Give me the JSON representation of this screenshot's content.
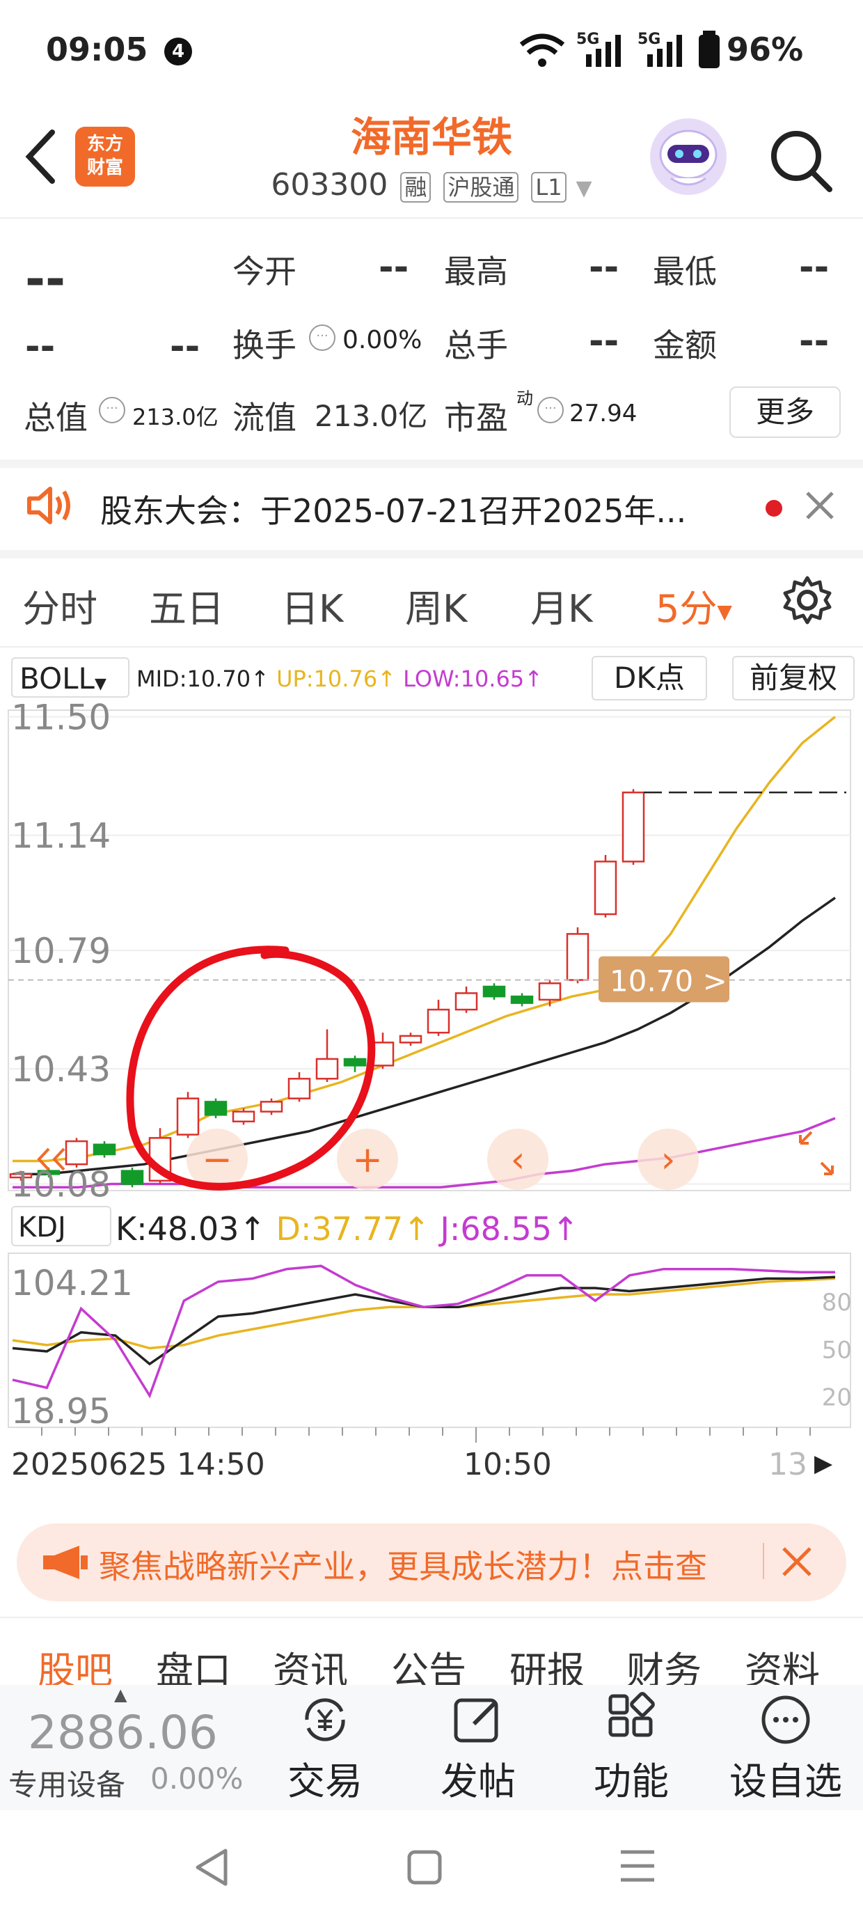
{
  "status_bar": {
    "time": "09:05",
    "notif_count": "4",
    "net1": "5G",
    "net2": "5G",
    "battery": "96%"
  },
  "header": {
    "logo_text_1": "东方",
    "logo_text_2": "财富",
    "stock_name": "海南华铁",
    "stock_code": "603300",
    "tags": [
      "融",
      "沪股通",
      "L1"
    ]
  },
  "quote": {
    "price": "--",
    "change": "--",
    "change_pct": "--",
    "rows": [
      [
        {
          "label": "今开",
          "value": "--"
        },
        {
          "label": "最高",
          "value": "--"
        },
        {
          "label": "最低",
          "value": "--"
        }
      ],
      [
        {
          "label": "换手",
          "value": "0.00%"
        },
        {
          "label": "总手",
          "value": "--"
        },
        {
          "label": "金额",
          "value": "--"
        }
      ]
    ],
    "total_value_label": "总值",
    "total_value": "213.0亿",
    "float_value_label": "流值",
    "float_value": "213.0亿",
    "pe_label": "市盈",
    "pe_sup": "动",
    "pe_value": "27.94",
    "more_label": "更多"
  },
  "notice": {
    "text": "股东大会：于2025-07-21召开2025年..."
  },
  "period_tabs": [
    "分时",
    "五日",
    "日K",
    "周K",
    "月K",
    "5分"
  ],
  "active_period": "5分",
  "indicator_bar": {
    "boll_label": "BOLL",
    "mid": "MID:10.70↑",
    "up": "UP:10.76↑",
    "low": "LOW:10.65↑",
    "dk_label": "DK点",
    "adj_label": "前复权"
  },
  "chart_data": {
    "type": "candlestick",
    "price_axis_labels": [
      "11.50",
      "11.14",
      "10.79",
      "10.43",
      "10.08"
    ],
    "ylim": [
      10.08,
      11.5
    ],
    "last_price_tag": "10.70 >",
    "candles": [
      {
        "o": 10.1,
        "c": 10.11,
        "h": 10.12,
        "l": 10.09
      },
      {
        "o": 10.12,
        "c": 10.11,
        "h": 10.13,
        "l": 10.1
      },
      {
        "o": 10.14,
        "c": 10.21,
        "h": 10.22,
        "l": 10.13
      },
      {
        "o": 10.2,
        "c": 10.17,
        "h": 10.21,
        "l": 10.16
      },
      {
        "o": 10.12,
        "c": 10.08,
        "h": 10.13,
        "l": 10.07
      },
      {
        "o": 10.09,
        "c": 10.22,
        "h": 10.25,
        "l": 10.08
      },
      {
        "o": 10.23,
        "c": 10.34,
        "h": 10.36,
        "l": 10.22
      },
      {
        "o": 10.33,
        "c": 10.29,
        "h": 10.34,
        "l": 10.28
      },
      {
        "o": 10.27,
        "c": 10.3,
        "h": 10.31,
        "l": 10.26
      },
      {
        "o": 10.3,
        "c": 10.33,
        "h": 10.34,
        "l": 10.29
      },
      {
        "o": 10.34,
        "c": 10.4,
        "h": 10.42,
        "l": 10.33
      },
      {
        "o": 10.4,
        "c": 10.46,
        "h": 10.55,
        "l": 10.39
      },
      {
        "o": 10.46,
        "c": 10.44,
        "h": 10.47,
        "l": 10.42
      },
      {
        "o": 10.44,
        "c": 10.51,
        "h": 10.54,
        "l": 10.43
      },
      {
        "o": 10.51,
        "c": 10.53,
        "h": 10.54,
        "l": 10.5
      },
      {
        "o": 10.54,
        "c": 10.61,
        "h": 10.64,
        "l": 10.53
      },
      {
        "o": 10.61,
        "c": 10.66,
        "h": 10.68,
        "l": 10.6
      },
      {
        "o": 10.68,
        "c": 10.65,
        "h": 10.69,
        "l": 10.64
      },
      {
        "o": 10.65,
        "c": 10.63,
        "h": 10.66,
        "l": 10.62
      },
      {
        "o": 10.64,
        "c": 10.69,
        "h": 10.7,
        "l": 10.62
      },
      {
        "o": 10.7,
        "c": 10.84,
        "h": 10.86,
        "l": 10.69
      },
      {
        "o": 10.9,
        "c": 11.06,
        "h": 11.08,
        "l": 10.89
      },
      {
        "o": 11.06,
        "c": 11.27,
        "h": 11.28,
        "l": 11.05
      }
    ],
    "upper_band": [
      10.15,
      10.15,
      10.16,
      10.18,
      10.2,
      10.24,
      10.29,
      10.31,
      10.33,
      10.36,
      10.39,
      10.43,
      10.47,
      10.51,
      10.55,
      10.59,
      10.62,
      10.65,
      10.67,
      10.72,
      10.84,
      11.0,
      11.16,
      11.3,
      11.42,
      11.5
    ],
    "mid_band": [
      10.11,
      10.11,
      10.12,
      10.13,
      10.14,
      10.16,
      10.18,
      10.2,
      10.22,
      10.24,
      10.27,
      10.3,
      10.33,
      10.36,
      10.39,
      10.42,
      10.45,
      10.48,
      10.51,
      10.55,
      10.6,
      10.66,
      10.73,
      10.8,
      10.88,
      10.95
    ],
    "lower_band": [
      10.07,
      10.07,
      10.07,
      10.08,
      10.08,
      10.08,
      10.08,
      10.07,
      10.07,
      10.07,
      10.07,
      10.07,
      10.07,
      10.07,
      10.08,
      10.09,
      10.11,
      10.12,
      10.14,
      10.15,
      10.16,
      10.18,
      10.2,
      10.22,
      10.24,
      10.28
    ],
    "high_dashed_level": 11.27,
    "last_price_level": 10.7,
    "kdj": {
      "label": "KDJ",
      "k": "K:48.03↑",
      "d": "D:37.77↑",
      "j": "J:68.55↑",
      "axis_labels": [
        "104.21",
        "18.95"
      ],
      "right_labels": [
        "80",
        "50",
        "20"
      ],
      "k_values": [
        50,
        48,
        60,
        58,
        40,
        55,
        70,
        72,
        76,
        80,
        84,
        80,
        76,
        76,
        80,
        84,
        88,
        88,
        86,
        88,
        90,
        92,
        94,
        94,
        95
      ],
      "d_values": [
        55,
        52,
        55,
        56,
        50,
        52,
        58,
        62,
        66,
        70,
        74,
        76,
        76,
        76,
        78,
        80,
        82,
        84,
        84,
        86,
        88,
        90,
        92,
        93,
        94
      ],
      "j_values": [
        30,
        25,
        75,
        55,
        20,
        80,
        92,
        94,
        100,
        102,
        90,
        82,
        76,
        78,
        86,
        96,
        96,
        80,
        96,
        100,
        100,
        100,
        99,
        98,
        98
      ]
    },
    "time_labels": [
      "20250625 14:50",
      "10:50",
      "13"
    ]
  },
  "overlay_buttons": [
    "−",
    "+",
    "‹",
    "›"
  ],
  "promo": {
    "text": "聚焦战略新兴产业，更具成长潜力！点击查"
  },
  "bottom_tabs": [
    "股吧",
    "盘口",
    "资讯",
    "公告",
    "研报",
    "财务",
    "资料"
  ],
  "active_bottom_tab": "股吧",
  "toolbar": {
    "index_value": "2886.06",
    "index_label": "专用设备",
    "index_change": "0.00%",
    "items": [
      "交易",
      "发帖",
      "功能",
      "设自选"
    ]
  },
  "colors": {
    "accent": "#f16a2a",
    "up": "#d9302b",
    "down": "#139b2a",
    "mid": "#222222",
    "upper": "#e8b520",
    "lower": "#c43bd0",
    "annotation": "#e8101a"
  }
}
